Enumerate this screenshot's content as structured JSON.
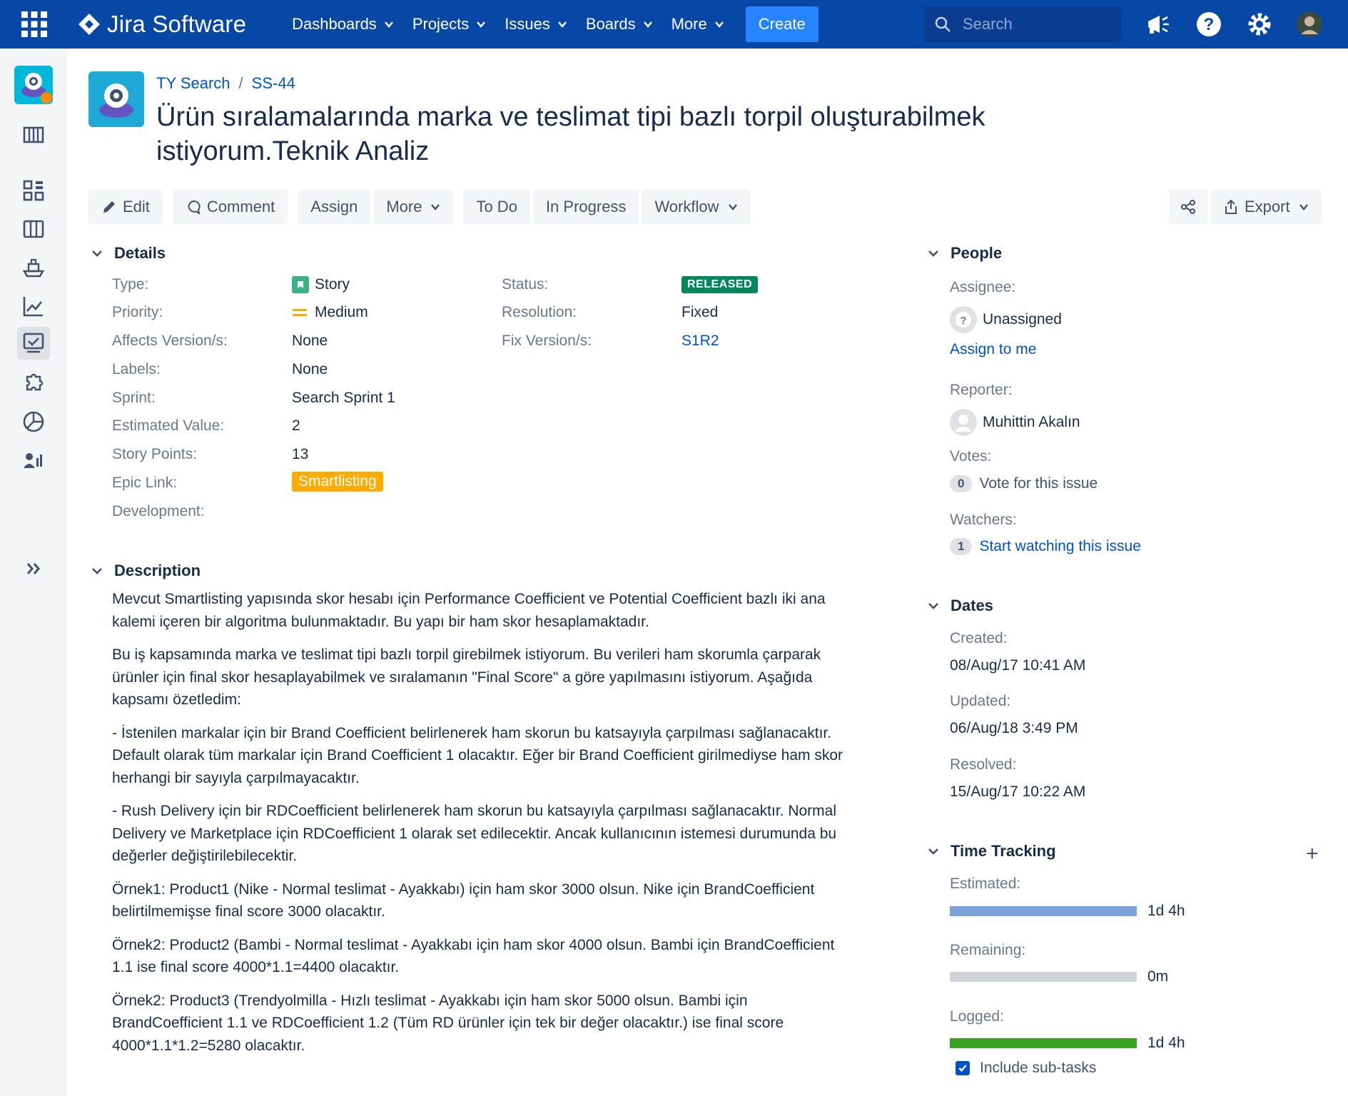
{
  "nav": {
    "brand": "Jira Software",
    "items": [
      "Dashboards",
      "Projects",
      "Issues",
      "Boards",
      "More"
    ],
    "create_label": "Create",
    "search_placeholder": "Search"
  },
  "breadcrumb": {
    "project": "TY Search",
    "separator": "/",
    "issue_key": "SS-44"
  },
  "issue": {
    "title": "Ürün sıralamalarında marka ve teslimat tipi bazlı torpil oluşturabilmek istiyorum.Teknik Analiz"
  },
  "toolbar": {
    "edit": "Edit",
    "comment": "Comment",
    "assign": "Assign",
    "more": "More",
    "todo": "To Do",
    "in_progress": "In Progress",
    "workflow": "Workflow",
    "export": "Export"
  },
  "details": {
    "heading": "Details",
    "type_label": "Type:",
    "type_value": "Story",
    "priority_label": "Priority:",
    "priority_value": "Medium",
    "affects_label": "Affects Version/s:",
    "affects_value": "None",
    "labels_label": "Labels:",
    "labels_value": "None",
    "sprint_label": "Sprint:",
    "sprint_value": "Search Sprint 1",
    "estimated_value_label": "Estimated Value:",
    "estimated_value_value": "2",
    "story_points_label": "Story Points:",
    "story_points_value": "13",
    "epic_label": "Epic Link:",
    "epic_value": "Smartlisting",
    "development_label": "Development:",
    "status_label": "Status:",
    "status_value": "RELEASED",
    "resolution_label": "Resolution:",
    "resolution_value": "Fixed",
    "fix_label": "Fix Version/s:",
    "fix_value": "S1R2"
  },
  "description": {
    "heading": "Description",
    "paragraphs": [
      "Mevcut Smartlisting yapısında skor hesabı için Performance Coefficient ve Potential Coefficient bazlı iki ana kalemi içeren bir algoritma bulunmaktadır. Bu yapı bir ham skor hesaplamaktadır.",
      "Bu iş kapsamında marka ve teslimat tipi bazlı torpil girebilmek istiyorum. Bu verileri ham skorumla çarparak ürünler için final skor hesaplayabilmek ve sıralamanın \"Final Score\" a göre yapılmasını istiyorum. Aşağıda kapsamı özetledim:",
      "- İstenilen markalar için bir Brand Coefficient belirlenerek ham skorun bu katsayıyla çarpılması sağlanacaktır. Default olarak tüm markalar için Brand Coefficient 1 olacaktır. Eğer bir Brand Coefficient girilmediyse ham skor herhangi bir sayıyla çarpılmayacaktır.",
      "- Rush Delivery için bir RDCoefficient belirlenerek ham skorun bu katsayıyla çarpılması sağlanacaktır. Normal Delivery ve Marketplace için RDCoefficient 1 olarak set edilecektir. Ancak kullanıcının istemesi durumunda bu değerler değiştirilebilecektir.",
      "Örnek1: Product1 (Nike - Normal teslimat - Ayakkabı) için ham skor 3000 olsun. Nike için BrandCoefficient belirtilmemişse final score 3000 olacaktır.",
      "Örnek2: Product2 (Bambi - Normal teslimat - Ayakkabı için ham skor 4000 olsun. Bambi için BrandCoefficient 1.1 ise final score 4000*1.1=4400 olacaktır.",
      "Örnek2: Product3 (Trendyolmilla - Hızlı teslimat - Ayakkabı için ham skor 5000 olsun. Bambi için BrandCoefficient 1.1 ve RDCoefficient 1.2 (Tüm RD ürünler için tek bir değer olacaktır.) ise final score 4000*1.1*1.2=5280 olacaktır."
    ]
  },
  "people": {
    "heading": "People",
    "assignee_label": "Assignee:",
    "assignee_value": "Unassigned",
    "assign_to_me": "Assign to me",
    "reporter_label": "Reporter:",
    "reporter_value": "Muhittin Akalın",
    "votes_label": "Votes:",
    "votes_count": "0",
    "vote_link": "Vote for this issue",
    "watchers_label": "Watchers:",
    "watchers_count": "1",
    "watch_link": "Start watching this issue"
  },
  "dates": {
    "heading": "Dates",
    "created_label": "Created:",
    "created_value": "08/Aug/17 10:41 AM",
    "updated_label": "Updated:",
    "updated_value": "06/Aug/18 3:49 PM",
    "resolved_label": "Resolved:",
    "resolved_value": "15/Aug/17 10:22 AM"
  },
  "time_tracking": {
    "heading": "Time Tracking",
    "add": "+",
    "estimated_label": "Estimated:",
    "estimated_value": "1d 4h",
    "estimated_fill": 1.0,
    "remaining_label": "Remaining:",
    "remaining_value": "0m",
    "remaining_fill": 0.0,
    "logged_label": "Logged:",
    "logged_value": "1d 4h",
    "logged_fill": 1.0,
    "include_subtasks": "Include sub-tasks",
    "include_subtasks_checked": true
  },
  "colors": {
    "nav_bg": "#0747a6",
    "create_bg": "#2684ff",
    "link": "#0052cc",
    "released": "#00875a",
    "epic": "#ffab00",
    "estimated_bar": "#7ca3d9",
    "remaining_bar": "#cfd3d9",
    "logged_bar": "#36a420"
  }
}
